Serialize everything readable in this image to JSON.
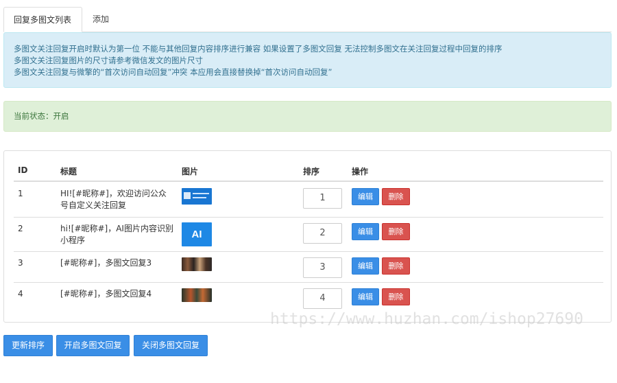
{
  "tabs": [
    {
      "label": "回复多图文列表",
      "active": true
    },
    {
      "label": "添加",
      "active": false
    }
  ],
  "info_alert": {
    "lines": [
      "多图文关注回复开启时默认为第一位 不能与其他回复内容排序进行兼容 如果设置了多图文回复 无法控制多图文在关注回复过程中回复的排序",
      "多图文关注回复图片的尺寸请参考微信发文的图片尺寸",
      "多图文关注回复与微擎的“首次访问自动回复”冲突 本应用会直接替换掉“首次访问自动回复”"
    ]
  },
  "status_alert": {
    "text": "当前状态：开启"
  },
  "table": {
    "headers": {
      "id": "ID",
      "title": "标题",
      "image": "图片",
      "order": "排序",
      "actions": "操作"
    },
    "rows": [
      {
        "id": "1",
        "title": "HI![#昵称#]，欢迎访问公众号自定义关注回复",
        "image_icon": "banner-thumbnail",
        "order": "1",
        "edit": "编辑",
        "delete": "删除"
      },
      {
        "id": "2",
        "title": "hi![#昵称#]，AI图片内容识别小程序",
        "image_icon": "ai-thumbnail",
        "image_text": "AI",
        "order": "2",
        "edit": "编辑",
        "delete": "删除"
      },
      {
        "id": "3",
        "title": "[#昵称#]，多图文回复3",
        "image_icon": "photo-thumbnail",
        "order": "3",
        "edit": "编辑",
        "delete": "删除"
      },
      {
        "id": "4",
        "title": "[#昵称#]，多图文回复4",
        "image_icon": "photo-thumbnail",
        "order": "4",
        "edit": "编辑",
        "delete": "删除"
      }
    ]
  },
  "footer_buttons": {
    "update_order": "更新排序",
    "enable": "开启多图文回复",
    "disable": "关闭多图文回复"
  },
  "watermark": "https://www.huzhan.com/ishop27690",
  "colors": {
    "primary": "#3a8ee6",
    "danger": "#d9534f",
    "info_bg": "#d9edf7",
    "success_bg": "#dff0d8"
  }
}
